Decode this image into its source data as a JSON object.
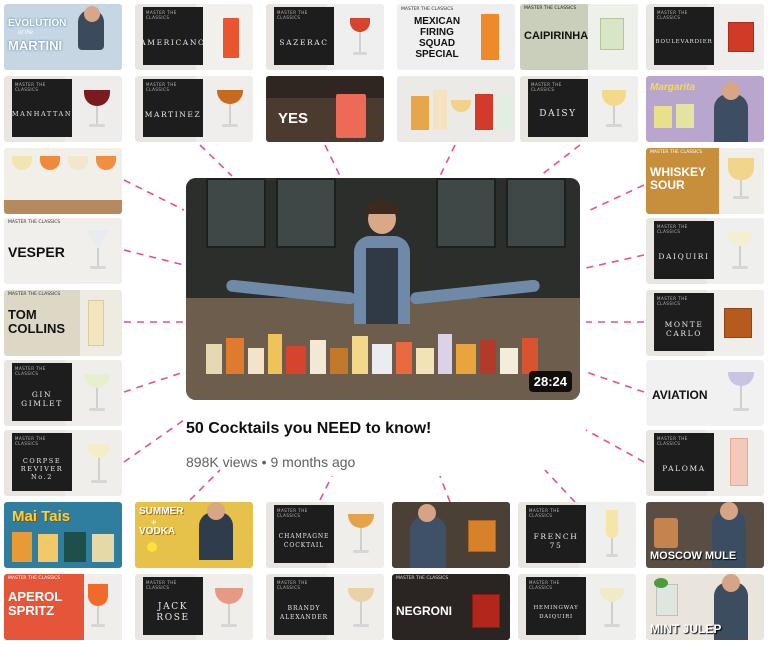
{
  "video": {
    "title": "50 Cocktails you NEED to know!",
    "views": "898K views",
    "separator": "•",
    "age": "9 months ago",
    "duration": "28:24"
  },
  "thumbnails": {
    "evolution_martini": {
      "line1": "EVOLUTION",
      "line2": "of the",
      "line3": "MARTINI"
    },
    "americano": {
      "name": "AMERICANO",
      "label": "MASTER THE CLASSICS"
    },
    "sazerac": {
      "name": "SAZERAC",
      "label": "MASTER THE CLASSICS"
    },
    "mexican_firing_squad": {
      "name": "MEXICAN\nFIRING\nSQUAD\nSPECIAL",
      "label": "MASTER THE CLASSICS"
    },
    "caipirinha": {
      "name": "CAIPIRINHA",
      "label": "MASTER THE CLASSICS"
    },
    "boulevardier": {
      "name": "BOULEVARDIER",
      "label": "MASTER THE CLASSICS"
    },
    "manhattan": {
      "name": "MANHATTAN",
      "label": "MASTER THE CLASSICS"
    },
    "martinez": {
      "name": "MARTINEZ",
      "label": "MASTER THE CLASSICS"
    },
    "yes": {
      "name": "YES"
    },
    "daisy": {
      "name": "DAISY",
      "label": "MASTER THE CLASSICS"
    },
    "margarita": {
      "name": "Margarita"
    },
    "whiskey_sour": {
      "name": "WHISKEY\nSOUR",
      "label": "MASTER THE CLASSICS"
    },
    "vesper": {
      "name": "VESPER",
      "label": "MASTER THE CLASSICS"
    },
    "daiquiri": {
      "name": "DAIQUIRI",
      "label": "MASTER THE CLASSICS"
    },
    "tom_collins": {
      "name": "TOM\nCOLLINS",
      "label": "MASTER THE CLASSICS"
    },
    "monte_carlo": {
      "name": "MONTE\nCARLO",
      "label": "MASTER THE CLASSICS"
    },
    "gin_gimlet": {
      "name": "GIN\nGIMLET",
      "label": "MASTER THE CLASSICS"
    },
    "aviation": {
      "name": "AVIATION"
    },
    "corpse_reviver": {
      "name": "CORPSE\nREVIVER\nNo.2",
      "label": "MASTER THE CLASSICS"
    },
    "paloma": {
      "name": "PALOMA",
      "label": "MASTER THE CLASSICS"
    },
    "mai_tais": {
      "name": "Mai Tais"
    },
    "summer_vodka": {
      "line1": "SUMMER",
      "line2": "+",
      "line3": "VODKA"
    },
    "champagne_cocktail": {
      "name": "CHAMPAGNE\nCOCKTAIL",
      "label": "MASTER THE CLASSICS"
    },
    "french_75": {
      "name": "FRENCH\n75",
      "label": "MASTER THE CLASSICS"
    },
    "moscow_mule": {
      "name": "MOSCOW MULE"
    },
    "aperol_spritz": {
      "name": "APEROL\nSPRITZ",
      "label": "MASTER THE CLASSICS"
    },
    "jack_rose": {
      "name": "JACK\nROSE",
      "label": "MASTER THE CLASSICS"
    },
    "brandy_alexander": {
      "name": "BRANDY\nALEXANDER",
      "label": "MASTER THE CLASSICS"
    },
    "negroni": {
      "name": "NEGRONI",
      "label": "MASTER THE CLASSICS"
    },
    "hemingway_daiquiri": {
      "name": "HEMINGWAY\nDAIQUIRI",
      "label": "MASTER THE CLASSICS"
    },
    "mint_julep": {
      "name": "MINT JULEP"
    }
  },
  "colors": {
    "connector": "#e8508a",
    "duration_bg": "#000000"
  }
}
